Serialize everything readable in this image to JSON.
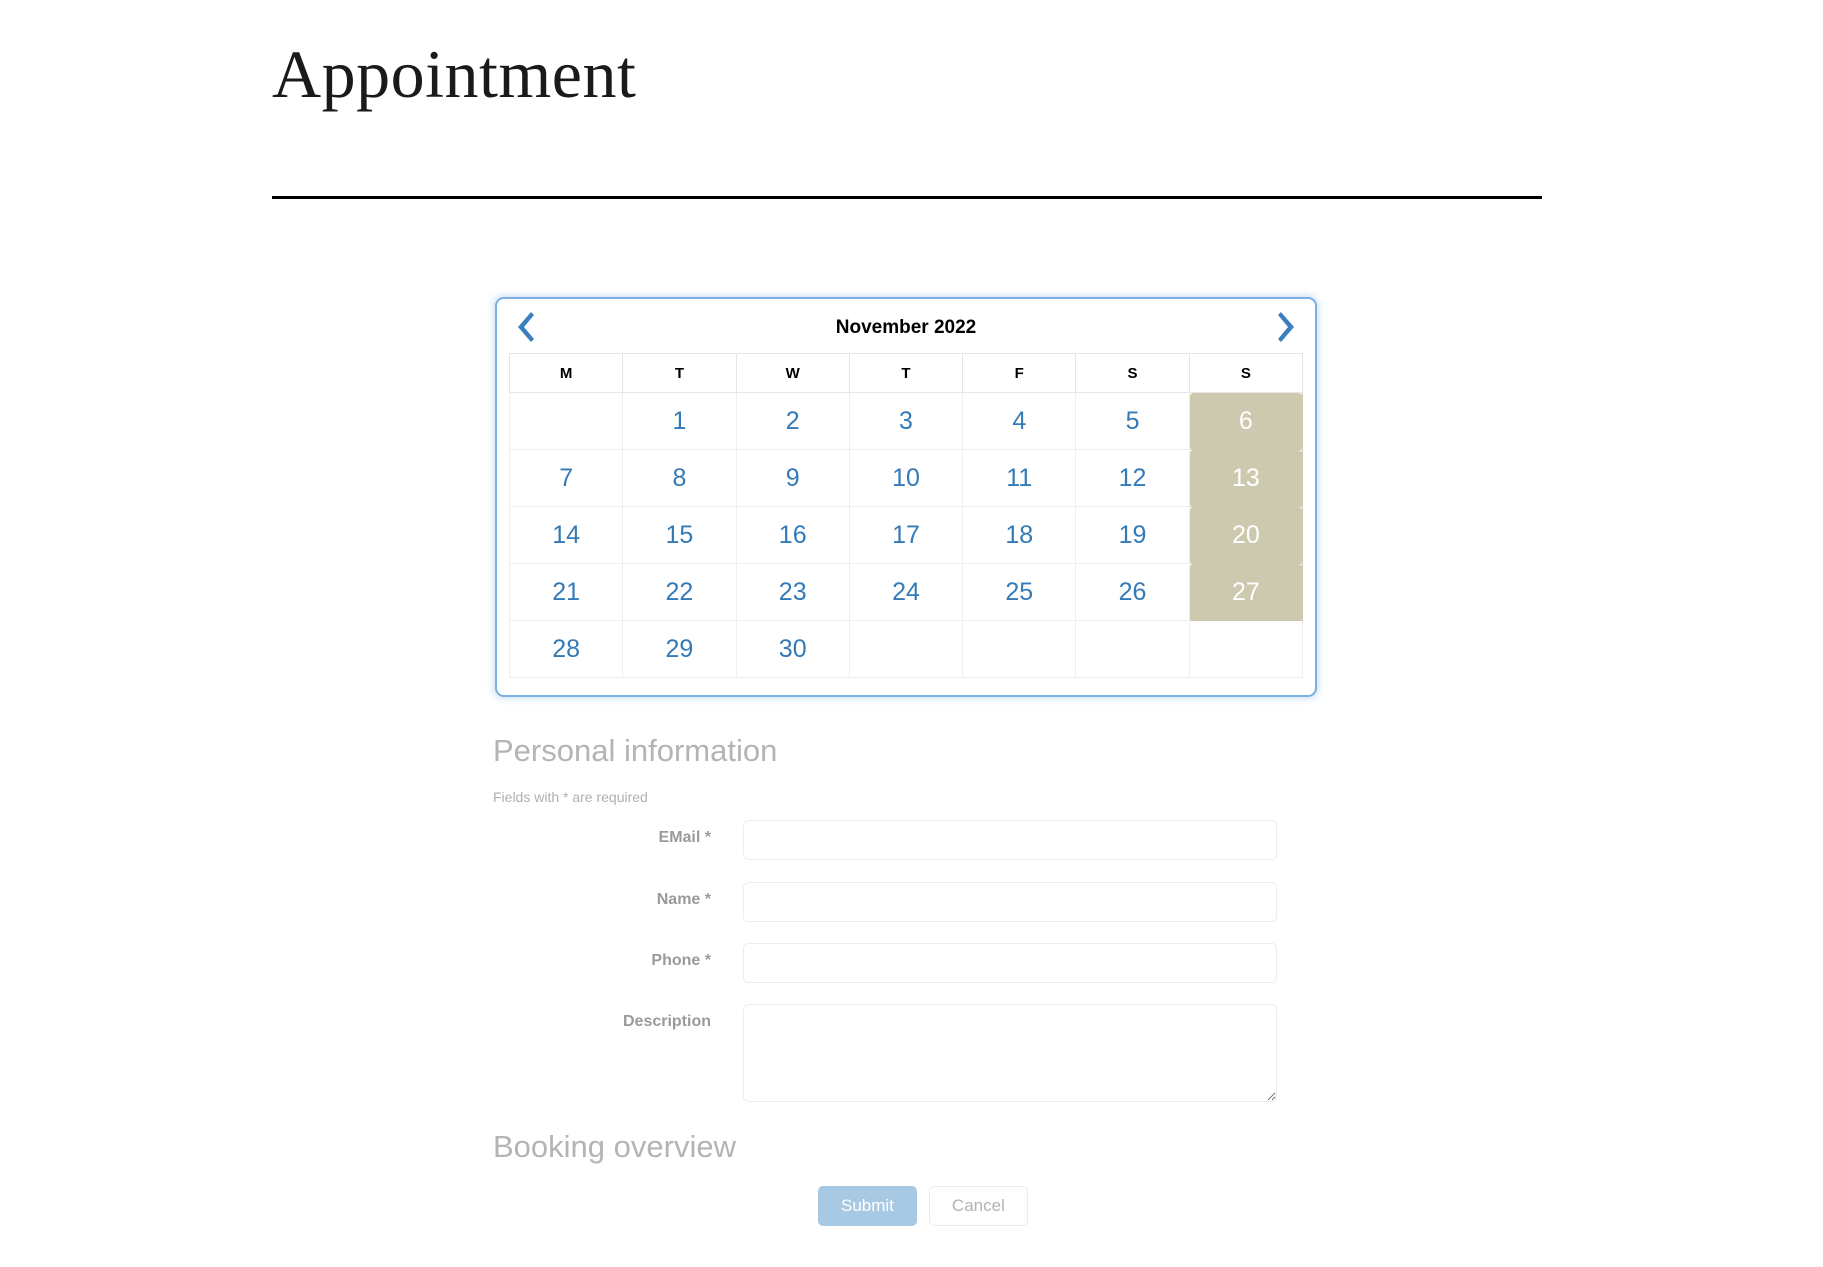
{
  "page": {
    "title": "Appointment"
  },
  "calendar": {
    "month_label": "November 2022",
    "prev_icon": "chevron-left-icon",
    "next_icon": "chevron-right-icon",
    "weekdays": [
      "M",
      "T",
      "W",
      "T",
      "F",
      "S",
      "S"
    ],
    "accent_border": "#7ab0e2",
    "day_color": "#337ab7",
    "disabled_bg": "#cdc9ae",
    "disabled_color": "#ffffff",
    "weeks": [
      [
        {
          "day": "",
          "state": "empty"
        },
        {
          "day": "1",
          "state": "available"
        },
        {
          "day": "2",
          "state": "available"
        },
        {
          "day": "3",
          "state": "available"
        },
        {
          "day": "4",
          "state": "available"
        },
        {
          "day": "5",
          "state": "available"
        },
        {
          "day": "6",
          "state": "disabled"
        }
      ],
      [
        {
          "day": "7",
          "state": "available"
        },
        {
          "day": "8",
          "state": "available"
        },
        {
          "day": "9",
          "state": "available"
        },
        {
          "day": "10",
          "state": "available"
        },
        {
          "day": "11",
          "state": "available"
        },
        {
          "day": "12",
          "state": "available"
        },
        {
          "day": "13",
          "state": "disabled"
        }
      ],
      [
        {
          "day": "14",
          "state": "available"
        },
        {
          "day": "15",
          "state": "available"
        },
        {
          "day": "16",
          "state": "available"
        },
        {
          "day": "17",
          "state": "available"
        },
        {
          "day": "18",
          "state": "available"
        },
        {
          "day": "19",
          "state": "available"
        },
        {
          "day": "20",
          "state": "disabled"
        }
      ],
      [
        {
          "day": "21",
          "state": "available"
        },
        {
          "day": "22",
          "state": "available"
        },
        {
          "day": "23",
          "state": "available"
        },
        {
          "day": "24",
          "state": "available"
        },
        {
          "day": "25",
          "state": "available"
        },
        {
          "day": "26",
          "state": "available"
        },
        {
          "day": "27",
          "state": "disabled"
        }
      ],
      [
        {
          "day": "28",
          "state": "available"
        },
        {
          "day": "29",
          "state": "available"
        },
        {
          "day": "30",
          "state": "available"
        },
        {
          "day": "",
          "state": "empty"
        },
        {
          "day": "",
          "state": "empty"
        },
        {
          "day": "",
          "state": "empty"
        },
        {
          "day": "",
          "state": "empty"
        }
      ]
    ]
  },
  "personal_section": {
    "heading": "Personal information",
    "required_note": "Fields with * are required",
    "fields": {
      "email": {
        "label": "EMail",
        "required_mark": "*",
        "value": "",
        "placeholder": ""
      },
      "name": {
        "label": "Name",
        "required_mark": "*",
        "value": "",
        "placeholder": ""
      },
      "phone": {
        "label": "Phone",
        "required_mark": "*",
        "value": "",
        "placeholder": ""
      },
      "description": {
        "label": "Description",
        "required_mark": "",
        "value": "",
        "placeholder": ""
      }
    }
  },
  "booking_section": {
    "heading": "Booking overview"
  },
  "actions": {
    "submit_label": "Submit",
    "cancel_label": "Cancel",
    "submit_color": "#a8c9e4"
  }
}
